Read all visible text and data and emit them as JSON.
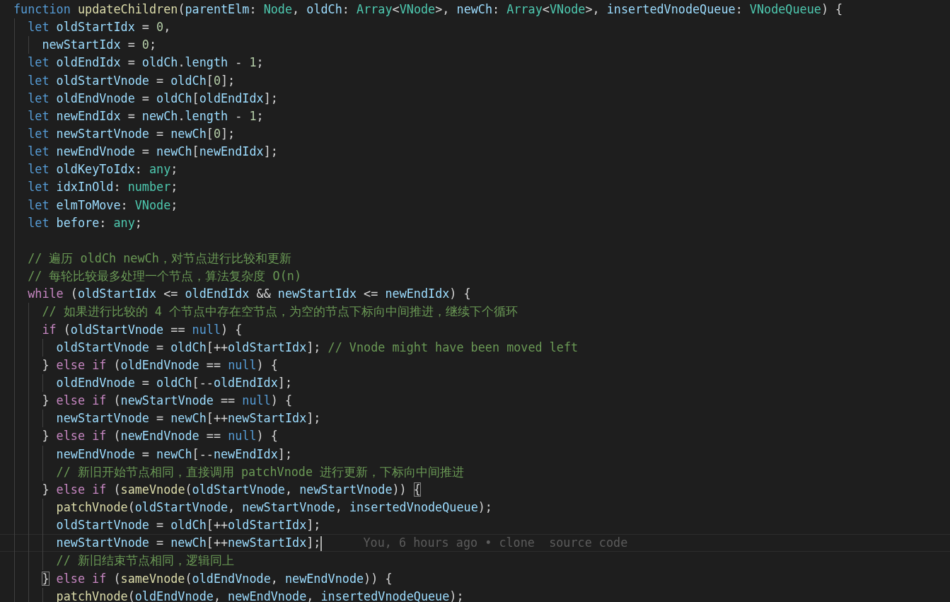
{
  "editor": {
    "lines": [
      {
        "kind": "code",
        "tokens": [
          {
            "kind": "kw",
            "text": "function "
          },
          {
            "kind": "fn",
            "text": "updateChildren"
          },
          {
            "kind": "p",
            "text": "("
          },
          {
            "kind": "var",
            "text": "parentElm"
          },
          {
            "kind": "p",
            "text": ": "
          },
          {
            "kind": "type",
            "text": "Node"
          },
          {
            "kind": "p",
            "text": ", "
          },
          {
            "kind": "var",
            "text": "oldCh"
          },
          {
            "kind": "p",
            "text": ": "
          },
          {
            "kind": "type",
            "text": "Array"
          },
          {
            "kind": "p",
            "text": "<"
          },
          {
            "kind": "type",
            "text": "VNode"
          },
          {
            "kind": "p",
            "text": ">, "
          },
          {
            "kind": "var",
            "text": "newCh"
          },
          {
            "kind": "p",
            "text": ": "
          },
          {
            "kind": "type",
            "text": "Array"
          },
          {
            "kind": "p",
            "text": "<"
          },
          {
            "kind": "type",
            "text": "VNode"
          },
          {
            "kind": "p",
            "text": ">, "
          },
          {
            "kind": "var",
            "text": "insertedVnodeQueue"
          },
          {
            "kind": "p",
            "text": ": "
          },
          {
            "kind": "type",
            "text": "VNodeQueue"
          },
          {
            "kind": "p",
            "text": ") {"
          }
        ],
        "children": [
          {
            "kind": "code",
            "tokens": [
              {
                "kind": "kw",
                "text": "let "
              },
              {
                "kind": "var",
                "text": "oldStartIdx"
              },
              {
                "kind": "p",
                "text": " = "
              },
              {
                "kind": "num",
                "text": "0"
              },
              {
                "kind": "p",
                "text": ","
              }
            ],
            "children": [
              {
                "kind": "code",
                "tokens": [
                  {
                    "kind": "var",
                    "text": "newStartIdx"
                  },
                  {
                    "kind": "p",
                    "text": " = "
                  },
                  {
                    "kind": "num",
                    "text": "0"
                  },
                  {
                    "kind": "p",
                    "text": ";"
                  }
                ]
              }
            ]
          },
          {
            "kind": "code",
            "tokens": [
              {
                "kind": "kw",
                "text": "let "
              },
              {
                "kind": "var",
                "text": "oldEndIdx"
              },
              {
                "kind": "p",
                "text": " = "
              },
              {
                "kind": "var",
                "text": "oldCh"
              },
              {
                "kind": "p",
                "text": "."
              },
              {
                "kind": "var",
                "text": "length"
              },
              {
                "kind": "p",
                "text": " - "
              },
              {
                "kind": "num",
                "text": "1"
              },
              {
                "kind": "p",
                "text": ";"
              }
            ]
          },
          {
            "kind": "code",
            "tokens": [
              {
                "kind": "kw",
                "text": "let "
              },
              {
                "kind": "var",
                "text": "oldStartVnode"
              },
              {
                "kind": "p",
                "text": " = "
              },
              {
                "kind": "var",
                "text": "oldCh"
              },
              {
                "kind": "p",
                "text": "["
              },
              {
                "kind": "num",
                "text": "0"
              },
              {
                "kind": "p",
                "text": "];"
              }
            ]
          },
          {
            "kind": "code",
            "tokens": [
              {
                "kind": "kw",
                "text": "let "
              },
              {
                "kind": "var",
                "text": "oldEndVnode"
              },
              {
                "kind": "p",
                "text": " = "
              },
              {
                "kind": "var",
                "text": "oldCh"
              },
              {
                "kind": "p",
                "text": "["
              },
              {
                "kind": "var",
                "text": "oldEndIdx"
              },
              {
                "kind": "p",
                "text": "];"
              }
            ]
          },
          {
            "kind": "code",
            "tokens": [
              {
                "kind": "kw",
                "text": "let "
              },
              {
                "kind": "var",
                "text": "newEndIdx"
              },
              {
                "kind": "p",
                "text": " = "
              },
              {
                "kind": "var",
                "text": "newCh"
              },
              {
                "kind": "p",
                "text": "."
              },
              {
                "kind": "var",
                "text": "length"
              },
              {
                "kind": "p",
                "text": " - "
              },
              {
                "kind": "num",
                "text": "1"
              },
              {
                "kind": "p",
                "text": ";"
              }
            ]
          },
          {
            "kind": "code",
            "tokens": [
              {
                "kind": "kw",
                "text": "let "
              },
              {
                "kind": "var",
                "text": "newStartVnode"
              },
              {
                "kind": "p",
                "text": " = "
              },
              {
                "kind": "var",
                "text": "newCh"
              },
              {
                "kind": "p",
                "text": "["
              },
              {
                "kind": "num",
                "text": "0"
              },
              {
                "kind": "p",
                "text": "];"
              }
            ]
          },
          {
            "kind": "code",
            "tokens": [
              {
                "kind": "kw",
                "text": "let "
              },
              {
                "kind": "var",
                "text": "newEndVnode"
              },
              {
                "kind": "p",
                "text": " = "
              },
              {
                "kind": "var",
                "text": "newCh"
              },
              {
                "kind": "p",
                "text": "["
              },
              {
                "kind": "var",
                "text": "newEndIdx"
              },
              {
                "kind": "p",
                "text": "];"
              }
            ]
          },
          {
            "kind": "code",
            "tokens": [
              {
                "kind": "kw",
                "text": "let "
              },
              {
                "kind": "var",
                "text": "oldKeyToIdx"
              },
              {
                "kind": "p",
                "text": ": "
              },
              {
                "kind": "type",
                "text": "any"
              },
              {
                "kind": "p",
                "text": ";"
              }
            ]
          },
          {
            "kind": "code",
            "tokens": [
              {
                "kind": "kw",
                "text": "let "
              },
              {
                "kind": "var",
                "text": "idxInOld"
              },
              {
                "kind": "p",
                "text": ": "
              },
              {
                "kind": "type",
                "text": "number"
              },
              {
                "kind": "p",
                "text": ";"
              }
            ]
          },
          {
            "kind": "code",
            "tokens": [
              {
                "kind": "kw",
                "text": "let "
              },
              {
                "kind": "var",
                "text": "elmToMove"
              },
              {
                "kind": "p",
                "text": ": "
              },
              {
                "kind": "type",
                "text": "VNode"
              },
              {
                "kind": "p",
                "text": ";"
              }
            ]
          },
          {
            "kind": "code",
            "tokens": [
              {
                "kind": "kw",
                "text": "let "
              },
              {
                "kind": "var",
                "text": "before"
              },
              {
                "kind": "p",
                "text": ": "
              },
              {
                "kind": "type",
                "text": "any"
              },
              {
                "kind": "p",
                "text": ";"
              }
            ]
          },
          {
            "kind": "blank"
          },
          {
            "kind": "code",
            "tokens": [
              {
                "kind": "cm",
                "text": "// 遍历 oldCh newCh，对节点进行比较和更新"
              }
            ]
          },
          {
            "kind": "code",
            "tokens": [
              {
                "kind": "cm",
                "text": "// 每轮比较最多处理一个节点，算法复杂度 O(n)"
              }
            ]
          },
          {
            "kind": "code",
            "tokens": [
              {
                "kind": "ctl",
                "text": "while"
              },
              {
                "kind": "p",
                "text": " ("
              },
              {
                "kind": "var",
                "text": "oldStartIdx"
              },
              {
                "kind": "p",
                "text": " <= "
              },
              {
                "kind": "var",
                "text": "oldEndIdx"
              },
              {
                "kind": "p",
                "text": " && "
              },
              {
                "kind": "var",
                "text": "newStartIdx"
              },
              {
                "kind": "p",
                "text": " <= "
              },
              {
                "kind": "var",
                "text": "newEndIdx"
              },
              {
                "kind": "p",
                "text": ") {"
              }
            ],
            "children": [
              {
                "kind": "code",
                "tokens": [
                  {
                    "kind": "cm",
                    "text": "// 如果进行比较的 4 个节点中存在空节点，为空的节点下标向中间推进，继续下个循环"
                  }
                ]
              },
              {
                "kind": "code",
                "tokens": [
                  {
                    "kind": "ctl",
                    "text": "if"
                  },
                  {
                    "kind": "p",
                    "text": " ("
                  },
                  {
                    "kind": "var",
                    "text": "oldStartVnode"
                  },
                  {
                    "kind": "p",
                    "text": " == "
                  },
                  {
                    "kind": "kw",
                    "text": "null"
                  },
                  {
                    "kind": "p",
                    "text": ") {"
                  }
                ],
                "children": [
                  {
                    "kind": "code",
                    "tokens": [
                      {
                        "kind": "var",
                        "text": "oldStartVnode"
                      },
                      {
                        "kind": "p",
                        "text": " = "
                      },
                      {
                        "kind": "var",
                        "text": "oldCh"
                      },
                      {
                        "kind": "p",
                        "text": "[++"
                      },
                      {
                        "kind": "var",
                        "text": "oldStartIdx"
                      },
                      {
                        "kind": "p",
                        "text": "]; "
                      },
                      {
                        "kind": "cm",
                        "text": "// Vnode might have been moved left"
                      }
                    ]
                  }
                ]
              },
              {
                "kind": "code",
                "tokens": [
                  {
                    "kind": "p",
                    "text": "} "
                  },
                  {
                    "kind": "ctl",
                    "text": "else if"
                  },
                  {
                    "kind": "p",
                    "text": " ("
                  },
                  {
                    "kind": "var",
                    "text": "oldEndVnode"
                  },
                  {
                    "kind": "p",
                    "text": " == "
                  },
                  {
                    "kind": "kw",
                    "text": "null"
                  },
                  {
                    "kind": "p",
                    "text": ") {"
                  }
                ],
                "children": [
                  {
                    "kind": "code",
                    "tokens": [
                      {
                        "kind": "var",
                        "text": "oldEndVnode"
                      },
                      {
                        "kind": "p",
                        "text": " = "
                      },
                      {
                        "kind": "var",
                        "text": "oldCh"
                      },
                      {
                        "kind": "p",
                        "text": "[--"
                      },
                      {
                        "kind": "var",
                        "text": "oldEndIdx"
                      },
                      {
                        "kind": "p",
                        "text": "];"
                      }
                    ]
                  }
                ]
              },
              {
                "kind": "code",
                "tokens": [
                  {
                    "kind": "p",
                    "text": "} "
                  },
                  {
                    "kind": "ctl",
                    "text": "else if"
                  },
                  {
                    "kind": "p",
                    "text": " ("
                  },
                  {
                    "kind": "var",
                    "text": "newStartVnode"
                  },
                  {
                    "kind": "p",
                    "text": " == "
                  },
                  {
                    "kind": "kw",
                    "text": "null"
                  },
                  {
                    "kind": "p",
                    "text": ") {"
                  }
                ],
                "children": [
                  {
                    "kind": "code",
                    "tokens": [
                      {
                        "kind": "var",
                        "text": "newStartVnode"
                      },
                      {
                        "kind": "p",
                        "text": " = "
                      },
                      {
                        "kind": "var",
                        "text": "newCh"
                      },
                      {
                        "kind": "p",
                        "text": "[++"
                      },
                      {
                        "kind": "var",
                        "text": "newStartIdx"
                      },
                      {
                        "kind": "p",
                        "text": "];"
                      }
                    ]
                  }
                ]
              },
              {
                "kind": "code",
                "tokens": [
                  {
                    "kind": "p",
                    "text": "} "
                  },
                  {
                    "kind": "ctl",
                    "text": "else if"
                  },
                  {
                    "kind": "p",
                    "text": " ("
                  },
                  {
                    "kind": "var",
                    "text": "newEndVnode"
                  },
                  {
                    "kind": "p",
                    "text": " == "
                  },
                  {
                    "kind": "kw",
                    "text": "null"
                  },
                  {
                    "kind": "p",
                    "text": ") {"
                  }
                ],
                "children": [
                  {
                    "kind": "code",
                    "tokens": [
                      {
                        "kind": "var",
                        "text": "newEndVnode"
                      },
                      {
                        "kind": "p",
                        "text": " = "
                      },
                      {
                        "kind": "var",
                        "text": "newCh"
                      },
                      {
                        "kind": "p",
                        "text": "[--"
                      },
                      {
                        "kind": "var",
                        "text": "newEndIdx"
                      },
                      {
                        "kind": "p",
                        "text": "];"
                      }
                    ]
                  },
                  {
                    "kind": "code",
                    "tokens": [
                      {
                        "kind": "cm",
                        "text": "// 新旧开始节点相同，直接调用 patchVnode 进行更新，下标向中间推进"
                      }
                    ]
                  }
                ]
              },
              {
                "kind": "code",
                "tokens": [
                  {
                    "kind": "p",
                    "text": "} "
                  },
                  {
                    "kind": "ctl",
                    "text": "else if"
                  },
                  {
                    "kind": "p",
                    "text": " ("
                  },
                  {
                    "kind": "fn",
                    "text": "sameVnode"
                  },
                  {
                    "kind": "p",
                    "text": "("
                  },
                  {
                    "kind": "var",
                    "text": "oldStartVnode"
                  },
                  {
                    "kind": "p",
                    "text": ", "
                  },
                  {
                    "kind": "var",
                    "text": "newStartVnode"
                  },
                  {
                    "kind": "p",
                    "text": ")) "
                  },
                  {
                    "kind": "match",
                    "text": "{"
                  }
                ],
                "children": [
                  {
                    "kind": "code",
                    "tokens": [
                      {
                        "kind": "fn",
                        "text": "patchVnode"
                      },
                      {
                        "kind": "p",
                        "text": "("
                      },
                      {
                        "kind": "var",
                        "text": "oldStartVnode"
                      },
                      {
                        "kind": "p",
                        "text": ", "
                      },
                      {
                        "kind": "var",
                        "text": "newStartVnode"
                      },
                      {
                        "kind": "p",
                        "text": ", "
                      },
                      {
                        "kind": "var",
                        "text": "insertedVnodeQueue"
                      },
                      {
                        "kind": "p",
                        "text": ");"
                      }
                    ]
                  },
                  {
                    "kind": "code",
                    "tokens": [
                      {
                        "kind": "var",
                        "text": "oldStartVnode"
                      },
                      {
                        "kind": "p",
                        "text": " = "
                      },
                      {
                        "kind": "var",
                        "text": "oldCh"
                      },
                      {
                        "kind": "p",
                        "text": "[++"
                      },
                      {
                        "kind": "var",
                        "text": "oldStartIdx"
                      },
                      {
                        "kind": "p",
                        "text": "];"
                      }
                    ]
                  },
                  {
                    "kind": "code",
                    "current": true,
                    "blame": "You, 6 hours ago • clone  source code",
                    "tokens": [
                      {
                        "kind": "var",
                        "text": "newStartVnode"
                      },
                      {
                        "kind": "p",
                        "text": " = "
                      },
                      {
                        "kind": "var",
                        "text": "newCh"
                      },
                      {
                        "kind": "p",
                        "text": "[++"
                      },
                      {
                        "kind": "var",
                        "text": "newStartIdx"
                      },
                      {
                        "kind": "p",
                        "text": "];"
                      }
                    ]
                  },
                  {
                    "kind": "code",
                    "tokens": [
                      {
                        "kind": "cm",
                        "text": "// 新旧结束节点相同，逻辑同上"
                      }
                    ]
                  }
                ]
              },
              {
                "kind": "code",
                "tokens": [
                  {
                    "kind": "match",
                    "text": "}"
                  },
                  {
                    "kind": "ctl",
                    "text": " else if"
                  },
                  {
                    "kind": "p",
                    "text": " ("
                  },
                  {
                    "kind": "fn",
                    "text": "sameVnode"
                  },
                  {
                    "kind": "p",
                    "text": "("
                  },
                  {
                    "kind": "var",
                    "text": "oldEndVnode"
                  },
                  {
                    "kind": "p",
                    "text": ", "
                  },
                  {
                    "kind": "var",
                    "text": "newEndVnode"
                  },
                  {
                    "kind": "p",
                    "text": ")) {"
                  }
                ],
                "children": [
                  {
                    "kind": "code",
                    "tokens": [
                      {
                        "kind": "fn",
                        "text": "patchVnode"
                      },
                      {
                        "kind": "p",
                        "text": "("
                      },
                      {
                        "kind": "var",
                        "text": "oldEndVnode"
                      },
                      {
                        "kind": "p",
                        "text": ", "
                      },
                      {
                        "kind": "var",
                        "text": "newEndVnode"
                      },
                      {
                        "kind": "p",
                        "text": ", "
                      },
                      {
                        "kind": "var",
                        "text": "insertedVnodeQueue"
                      },
                      {
                        "kind": "p",
                        "text": ");"
                      }
                    ]
                  }
                ]
              }
            ]
          }
        ]
      }
    ]
  }
}
